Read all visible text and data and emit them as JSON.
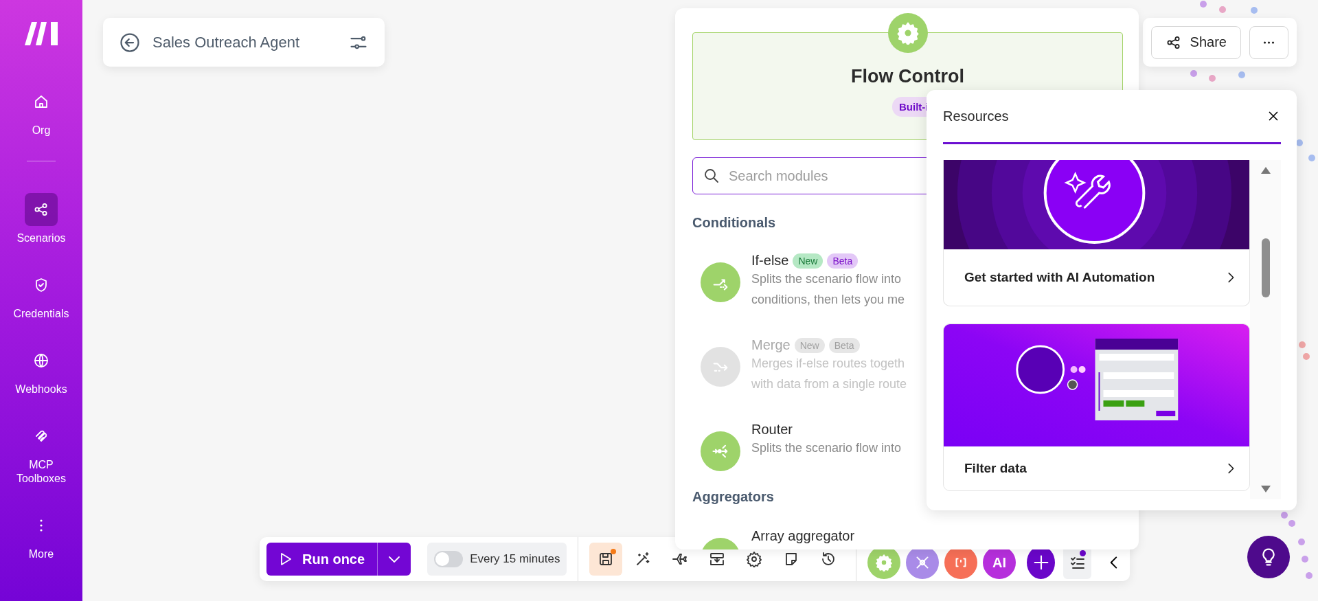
{
  "sidebar": {
    "items": [
      {
        "label": "Org",
        "selected": false
      },
      {
        "label": "Scenarios",
        "selected": true
      },
      {
        "label": "Credentials",
        "selected": false
      },
      {
        "label": "Webhooks",
        "selected": false
      },
      {
        "label": "MCP Toolboxes",
        "selected": false
      },
      {
        "label": "More",
        "selected": false
      }
    ]
  },
  "scenario": {
    "title": "Sales Outreach Agent"
  },
  "header_actions": {
    "share": "Share"
  },
  "module_panel": {
    "title": "Flow Control",
    "badge": "Built-i",
    "search": {
      "placeholder": "Search modules"
    },
    "sections": [
      {
        "heading": "Conditionals",
        "modules": [
          {
            "name": "If-else",
            "kind": "split",
            "disabled": false,
            "tags": [
              {
                "label": "New",
                "kind": "new"
              },
              {
                "label": "Beta",
                "kind": "beta"
              }
            ],
            "description": "Splits the scenario flow into\nconditions, then lets you me"
          },
          {
            "name": "Merge",
            "kind": "merge",
            "disabled": true,
            "tags": [
              {
                "label": "New",
                "kind": "new"
              },
              {
                "label": "Beta",
                "kind": "beta"
              }
            ],
            "description": "Merges if-else routes togeth\nwith data from a single route"
          },
          {
            "name": "Router",
            "kind": "router",
            "disabled": false,
            "description": "Splits the scenario flow into"
          }
        ]
      },
      {
        "heading": "Aggregators",
        "modules": [
          {
            "name": "Array aggregator",
            "kind": "aggregator",
            "disabled": false
          }
        ]
      }
    ]
  },
  "resources": {
    "title": "Resources",
    "cards": [
      {
        "title": "Get started with AI Automation",
        "kind": "picture"
      },
      {
        "title": "Filter data",
        "kind": "picture"
      }
    ]
  },
  "toolbar": {
    "run": {
      "label": "Run once"
    },
    "schedule": {
      "on": false,
      "label": "Every 15 minutes"
    },
    "tools": [
      {
        "active": true
      },
      {
        "active": false
      },
      {
        "active": false
      },
      {
        "active": false
      },
      {
        "active": false
      },
      {
        "active": false
      },
      {
        "active": false
      }
    ],
    "apps": [
      {
        "kind": "gear",
        "color": "#9ed36a"
      },
      {
        "kind": "tools",
        "color": "#a98be8"
      },
      {
        "kind": "brackets",
        "color": "#f66f57"
      },
      {
        "kind": "text",
        "label": "AI",
        "color": "#b62fdc"
      }
    ],
    "tasks": {
      "unread": true
    }
  }
}
